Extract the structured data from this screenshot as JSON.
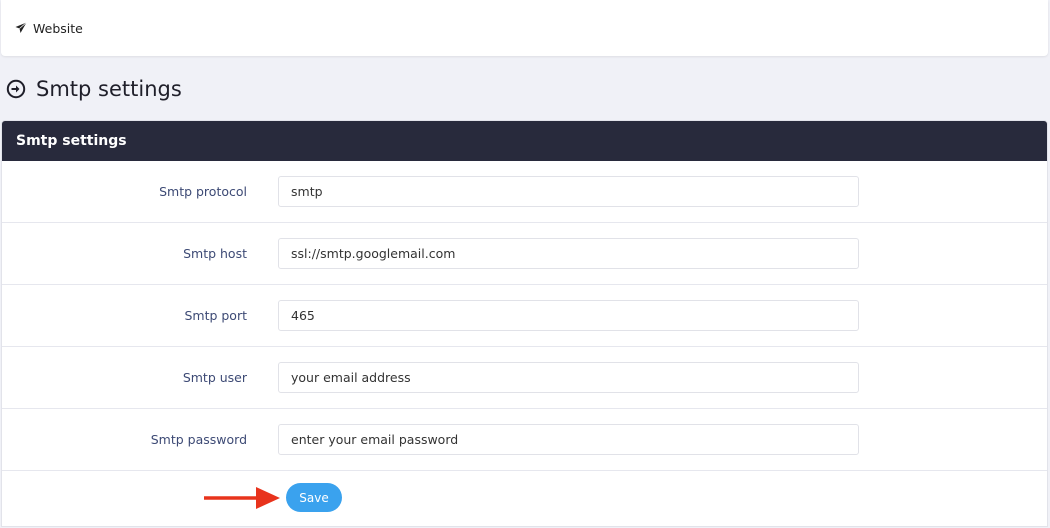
{
  "topbar": {
    "nav_label": "Website"
  },
  "page": {
    "title": "Smtp settings"
  },
  "card": {
    "title": "Smtp settings",
    "fields": [
      {
        "label": "Smtp protocol",
        "value": "smtp"
      },
      {
        "label": "Smtp host",
        "value": "ssl://smtp.googlemail.com"
      },
      {
        "label": "Smtp port",
        "value": "465"
      },
      {
        "label": "Smtp user",
        "value": "your email address"
      },
      {
        "label": "Smtp password",
        "value": "enter your email password"
      }
    ],
    "save_label": "Save"
  },
  "icons": {
    "nav": "paper-plane-icon",
    "heading": "circle-arrow-right-icon",
    "annotation": "red-arrow-icon"
  },
  "colors": {
    "header_bg": "#282a3c",
    "save_button": "#3aa2ee",
    "label": "#3d4a75",
    "annotation_arrow": "#e8331c"
  }
}
